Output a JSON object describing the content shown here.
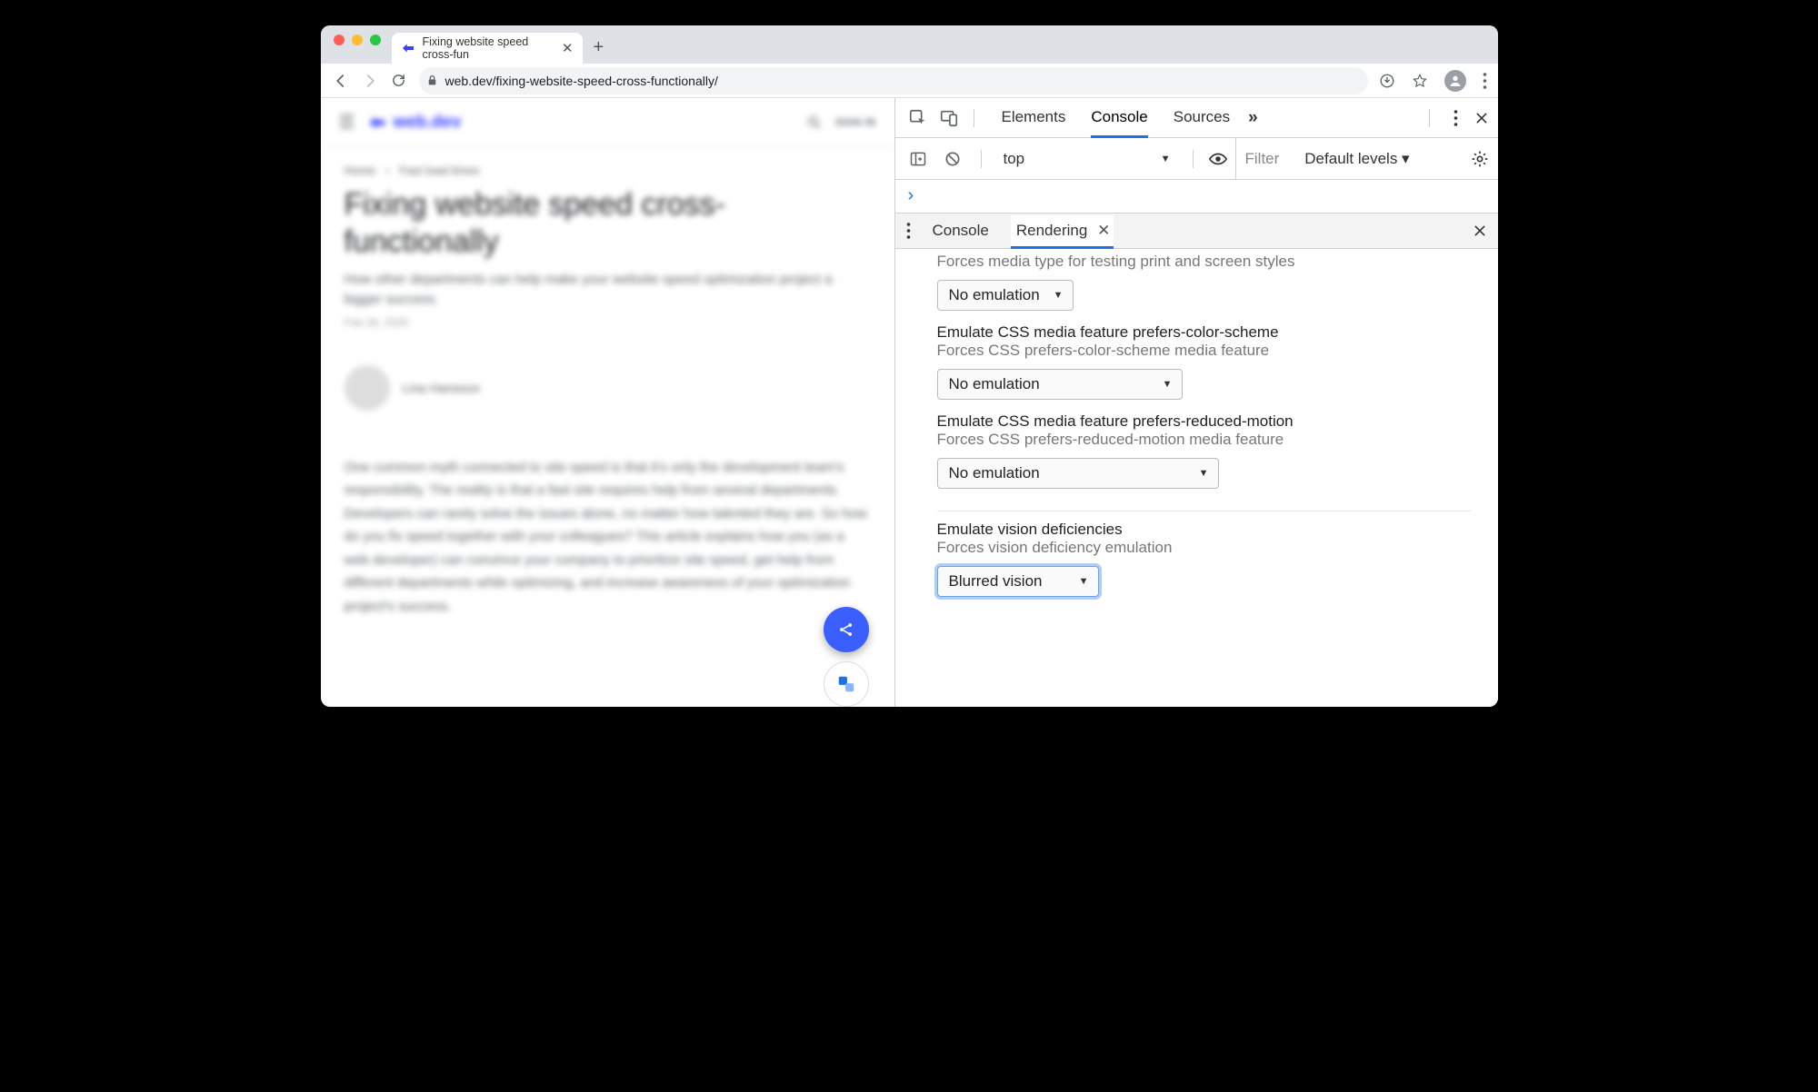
{
  "browser": {
    "tab_title": "Fixing website speed cross-fun",
    "url": "web.dev/fixing-website-speed-cross-functionally/"
  },
  "page": {
    "brand": "web.dev",
    "signin": "SIGN IN",
    "breadcrumb_home": "Home",
    "breadcrumb_sep": "›",
    "breadcrumb_sec": "Fast load times",
    "title": "Fixing website speed cross-functionally",
    "subtitle": "How other departments can help make your website speed optimization project a bigger success.",
    "date": "Feb 28, 2020",
    "author": "Lina Hansson",
    "body": "One common myth connected to site speed is that it's only the development team's responsibility. The reality is that a fast site requires help from several departments. Developers can rarely solve the issues alone, no matter how talented they are. So how do you fix speed together with your colleagues? This article explains how you (as a web developer) can convince your company to prioritize site speed, get help from different departments while optimizing, and increase awareness of your optimization project's success."
  },
  "devtools": {
    "tabs": {
      "elements": "Elements",
      "console": "Console",
      "sources": "Sources"
    },
    "console_bar": {
      "context": "top",
      "filter_placeholder": "Filter",
      "levels": "Default levels ▾"
    },
    "drawer": {
      "tab_console": "Console",
      "tab_rendering": "Rendering"
    },
    "rendering": {
      "media_type_desc": "Forces media type for testing print and screen styles",
      "media_type_value": "No emulation",
      "color_scheme_title": "Emulate CSS media feature prefers-color-scheme",
      "color_scheme_desc": "Forces CSS prefers-color-scheme media feature",
      "color_scheme_value": "No emulation",
      "reduced_motion_title": "Emulate CSS media feature prefers-reduced-motion",
      "reduced_motion_desc": "Forces CSS prefers-reduced-motion media feature",
      "reduced_motion_value": "No emulation",
      "vision_title": "Emulate vision deficiencies",
      "vision_desc": "Forces vision deficiency emulation",
      "vision_value": "Blurred vision"
    }
  }
}
